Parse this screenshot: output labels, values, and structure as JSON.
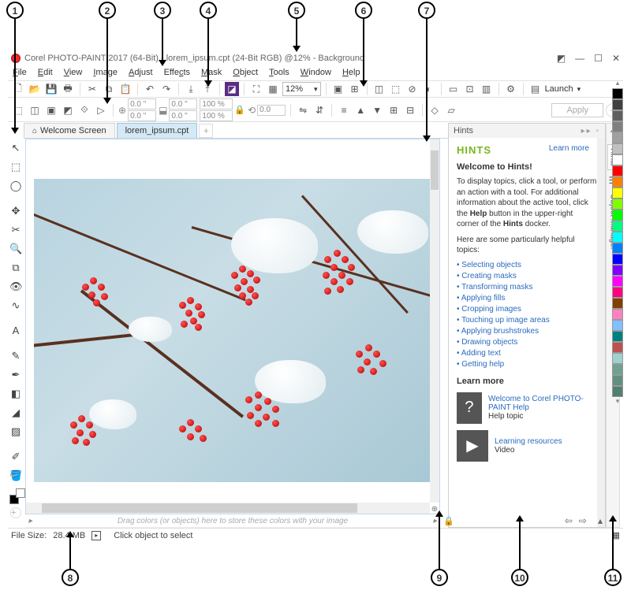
{
  "title": "Corel PHOTO-PAINT 2017 (64-Bit) - lorem_ipsum.cpt (24-Bit RGB) @12% - Background",
  "menu": [
    "File",
    "Edit",
    "View",
    "Image",
    "Adjust",
    "Effects",
    "Mask",
    "Object",
    "Tools",
    "Window",
    "Help"
  ],
  "zoom": "12%",
  "launch_label": "Launch",
  "apply_label": "Apply",
  "propbar": {
    "x": "0.0 \"",
    "y": "0.0 \"",
    "w": "0.0 \"",
    "h": "0.0 \"",
    "sx": "100 %",
    "sy": "100 %",
    "rot": "0.0"
  },
  "tabs": {
    "welcome": "Welcome Screen",
    "doc": "lorem_ipsum.cpt"
  },
  "hints": {
    "docker_title": "Hints",
    "heading": "HINTS",
    "learn_more": "Learn more",
    "welcome": "Welcome to Hints!",
    "intro1": "To display topics, click a tool, or perform an action with a tool. For additional information about the active tool, click the ",
    "intro_bold": "Help",
    "intro2": " button in the upper-right corner of the ",
    "intro_bold2": "Hints",
    "intro3": " docker.",
    "helpful": "Here are some particularly helpful topics:",
    "topics": [
      "Selecting objects",
      "Creating masks",
      "Transforming masks",
      "Applying fills",
      "Cropping images",
      "Touching up image areas",
      "Applying brushstrokes",
      "Drawing objects",
      "Adding text",
      "Getting help"
    ],
    "learn_more_h": "Learn more",
    "lm1_title": "Welcome to Corel PHOTO-PAINT Help",
    "lm1_sub": "Help topic",
    "lm2_title": "Learning resources",
    "lm2_sub": "Video"
  },
  "docker_tabs": {
    "hints": "Hints",
    "objmgr": "Object Manager"
  },
  "colorstrip_hint": "Drag colors (or objects) here to store these colors with your image",
  "status": {
    "filesize_label": "File Size:",
    "filesize": "28.4 MB",
    "hint": "Click object to select"
  },
  "palette": [
    "#000000",
    "#404040",
    "#606060",
    "#808080",
    "#a0a0a0",
    "#c0c0c0",
    "#ffffff",
    "#ff0000",
    "#ff8000",
    "#ffff00",
    "#80ff00",
    "#00ff00",
    "#00ff80",
    "#00ffff",
    "#0080ff",
    "#0000ff",
    "#8000ff",
    "#ff00ff",
    "#ff0080",
    "#804000",
    "#ff80c0",
    "#80c0ff",
    "#008080",
    "#c05050",
    "#a0d0d0",
    "#70a090",
    "#609080",
    "#508070"
  ],
  "callouts": [
    "1",
    "2",
    "3",
    "4",
    "5",
    "6",
    "7",
    "8",
    "9",
    "10",
    "11"
  ]
}
